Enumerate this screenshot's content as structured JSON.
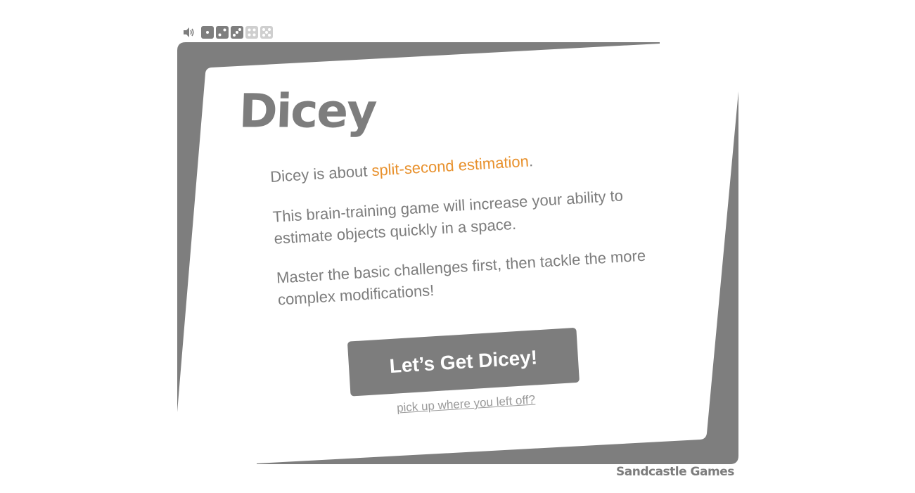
{
  "toolbar": {
    "sound_icon": "speaker-icon",
    "dice": [
      {
        "face": 1,
        "state": "on"
      },
      {
        "face": 2,
        "state": "on"
      },
      {
        "face": 3,
        "state": "on"
      },
      {
        "face": 4,
        "state": "off"
      },
      {
        "face": 5,
        "state": "off"
      }
    ]
  },
  "title": "Dicey",
  "intro": {
    "prefix": "Dicey is about ",
    "highlight": "split-second estimation",
    "suffix": "."
  },
  "paragraphs": [
    "This brain-training game will increase your ability to estimate objects quickly in a space.",
    "Master the basic challenges first, then tackle the more complex modifications!"
  ],
  "cta_label": "Let’s Get Dicey!",
  "resume_label": "pick up where you left off?",
  "brand": "Sandcastle Games",
  "colors": {
    "frame": "#7d7d7d",
    "accent": "#e8912d",
    "inactive_die": "#cfcfcf"
  }
}
